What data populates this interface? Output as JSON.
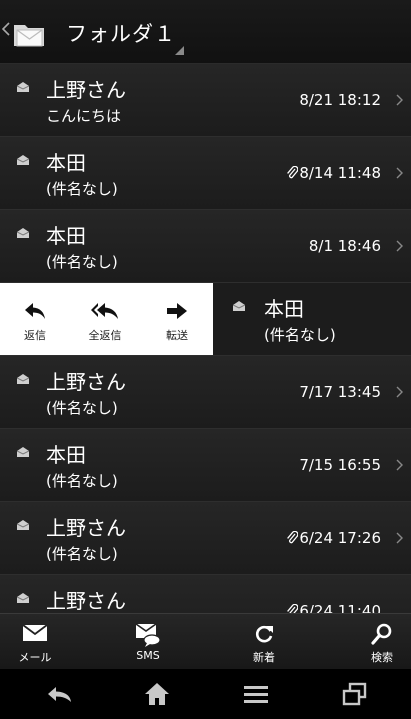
{
  "header": {
    "title": "フォルダ１",
    "icon": "mail-folder-icon"
  },
  "messages": [
    {
      "from": "上野さん",
      "subject": "こんにちは",
      "time": "8/21 18:12",
      "attachment": false
    },
    {
      "from": "本田",
      "subject": "(件名なし)",
      "time": "8/14 11:48",
      "attachment": true
    },
    {
      "from": "本田",
      "subject": "(件名なし)",
      "time": "8/1 18:46",
      "attachment": false
    },
    {
      "from": "本田",
      "subject": "(件名なし)",
      "time": "",
      "attachment": false
    },
    {
      "from": "上野さん",
      "subject": "(件名なし)",
      "time": "7/17 13:45",
      "attachment": false
    },
    {
      "from": "本田",
      "subject": "(件名なし)",
      "time": "7/15 16:55",
      "attachment": false
    },
    {
      "from": "上野さん",
      "subject": "(件名なし)",
      "time": "6/24 17:26",
      "attachment": true
    },
    {
      "from": "上野さん",
      "subject": "",
      "time": "6/24 11:40",
      "attachment": true
    }
  ],
  "swipe_actions": {
    "reply": "返信",
    "reply_all": "全返信",
    "forward": "転送"
  },
  "bottom_bar": {
    "mail": "メール",
    "sms": "SMS",
    "refresh": "新着",
    "search": "検索"
  },
  "colors": {
    "header_bg": "#151515",
    "row_bg": "#222222",
    "action_bg": "#ffffff"
  }
}
